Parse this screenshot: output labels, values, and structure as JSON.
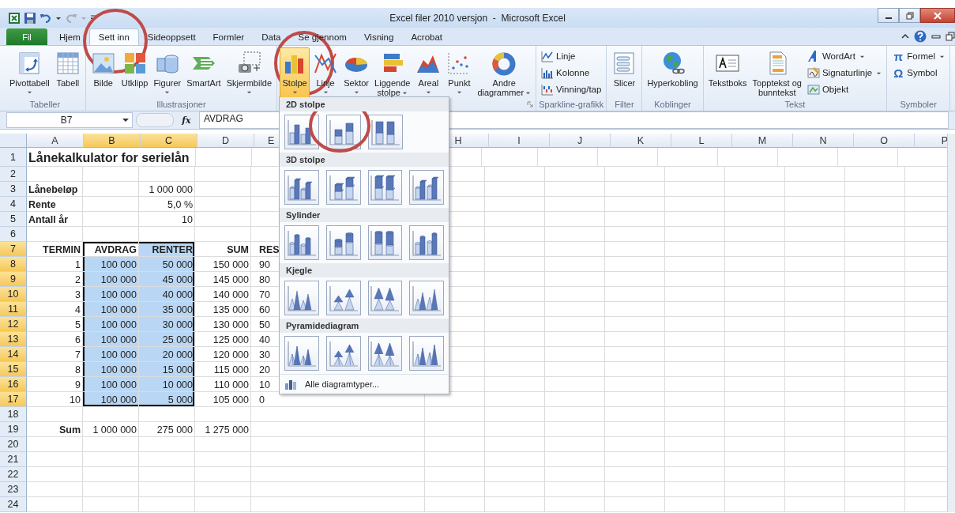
{
  "window": {
    "title": "Excel filer 2010 versjon  -  Microsoft Excel"
  },
  "tabs": [
    {
      "label": "Fil",
      "kind": "file",
      "selected": false
    },
    {
      "label": "Hjem",
      "kind": "tab",
      "selected": false
    },
    {
      "label": "Sett inn",
      "kind": "tab",
      "selected": true
    },
    {
      "label": "Sideoppsett",
      "kind": "tab",
      "selected": false
    },
    {
      "label": "Formler",
      "kind": "tab",
      "selected": false
    },
    {
      "label": "Data",
      "kind": "tab",
      "selected": false
    },
    {
      "label": "Se gjennom",
      "kind": "tab",
      "selected": false
    },
    {
      "label": "Visning",
      "kind": "tab",
      "selected": false
    },
    {
      "label": "Acrobat",
      "kind": "tab",
      "selected": false
    }
  ],
  "ribbon_groups": [
    {
      "label": "Tabeller",
      "items": [
        {
          "label": "Pivottabell",
          "kind": "large",
          "dropdown": true,
          "pressed": false
        },
        {
          "label": "Tabell",
          "kind": "large",
          "dropdown": false,
          "pressed": false
        }
      ]
    },
    {
      "label": "Illustrasjoner",
      "items": [
        {
          "label": "Bilde",
          "kind": "large",
          "dropdown": false,
          "pressed": false
        },
        {
          "label": "Utklipp",
          "kind": "large",
          "dropdown": false,
          "pressed": false
        },
        {
          "label": "Figurer",
          "kind": "large",
          "dropdown": true,
          "pressed": false
        },
        {
          "label": "SmartArt",
          "kind": "large",
          "dropdown": false,
          "pressed": false
        },
        {
          "label": "Skjermbilde",
          "kind": "large",
          "dropdown": true,
          "pressed": false
        }
      ]
    },
    {
      "dialog_launcher": true,
      "items": [
        {
          "label": "Stolpe",
          "kind": "large",
          "dropdown": true,
          "pressed": true
        },
        {
          "label": "Linje",
          "kind": "large",
          "dropdown": true,
          "pressed": false
        },
        {
          "label": "Sektor",
          "kind": "large",
          "dropdown": true,
          "pressed": false
        },
        {
          "label": "Liggende\nstolpe",
          "kind": "large",
          "dropdown": true,
          "pressed": false
        },
        {
          "label": "Areal",
          "kind": "large",
          "dropdown": true,
          "pressed": false
        },
        {
          "label": "Punkt",
          "kind": "large",
          "dropdown": true,
          "pressed": false
        },
        {
          "label": "Andre\ndiagrammer",
          "kind": "large",
          "dropdown": true,
          "pressed": false
        }
      ]
    },
    {
      "label": "Sparkline-grafikk",
      "items": [
        {
          "label": "Linje",
          "kind": "small",
          "dropdown": false,
          "pressed": false
        },
        {
          "label": "Kolonne",
          "kind": "small",
          "dropdown": false,
          "pressed": false
        },
        {
          "label": "Vinning/tap",
          "kind": "small",
          "dropdown": false,
          "pressed": false
        }
      ]
    },
    {
      "label": "Filter",
      "items": [
        {
          "label": "Slicer",
          "kind": "large",
          "dropdown": false,
          "pressed": false
        }
      ]
    },
    {
      "label": "Koblinger",
      "items": [
        {
          "label": "Hyperkobling",
          "kind": "large",
          "dropdown": false,
          "pressed": false
        }
      ]
    },
    {
      "label": "Tekst",
      "items": [
        {
          "label": "Tekstboks",
          "kind": "large",
          "dropdown": false,
          "pressed": false
        },
        {
          "label": "Topptekst og\nbunntekst",
          "kind": "large",
          "dropdown": false,
          "pressed": false
        },
        {
          "label": "WordArt",
          "kind": "small",
          "dropdown": true,
          "pressed": false
        },
        {
          "label": "Signaturlinje",
          "kind": "small",
          "dropdown": true,
          "pressed": false
        },
        {
          "label": "Objekt",
          "kind": "small",
          "dropdown": false,
          "pressed": false
        }
      ]
    },
    {
      "label": "Symboler",
      "items": [
        {
          "label": "Formel",
          "kind": "small",
          "glyph": "π",
          "dropdown": true,
          "pressed": false
        },
        {
          "label": "Symbol",
          "kind": "small",
          "glyph": "Ω",
          "dropdown": false,
          "pressed": false
        }
      ]
    }
  ],
  "formula_bar": {
    "name_box": "B7",
    "fx_label": "fx",
    "formula": "AVDRAG"
  },
  "sheet": {
    "columns": [
      {
        "label": "A",
        "covered": false
      },
      {
        "label": "B",
        "covered": false
      },
      {
        "label": "C",
        "covered": false
      },
      {
        "label": "D",
        "covered": false
      },
      {
        "label": "E",
        "covered": true
      },
      {
        "label": "H",
        "covered": false
      },
      {
        "label": "I",
        "covered": false
      },
      {
        "label": "J",
        "covered": false
      },
      {
        "label": "K",
        "covered": false
      },
      {
        "label": "L",
        "covered": false
      },
      {
        "label": "M",
        "covered": false
      },
      {
        "label": "N",
        "covered": false
      },
      {
        "label": "O",
        "covered": false
      },
      {
        "label": "P",
        "covered": false
      }
    ],
    "rows": [
      {
        "header": "1",
        "kind": "title",
        "cells": {
          "A": {
            "text": "Lånekalkulator for serielån",
            "kind": "text",
            "bold": true,
            "selected": false,
            "active": false
          }
        }
      },
      {
        "header": "2",
        "kind": "normal",
        "cells": {}
      },
      {
        "header": "3",
        "kind": "normal",
        "cells": {
          "A": {
            "text": "Lånebeløp",
            "kind": "text",
            "bold": true,
            "selected": false,
            "active": false
          },
          "C": {
            "text": "1 000 000",
            "kind": "number",
            "bold": false,
            "selected": false,
            "active": false
          }
        }
      },
      {
        "header": "4",
        "kind": "normal",
        "cells": {
          "A": {
            "text": "Rente",
            "kind": "text",
            "bold": true,
            "selected": false,
            "active": false
          },
          "C": {
            "text": "5,0 %",
            "kind": "number",
            "bold": false,
            "selected": false,
            "active": false
          }
        }
      },
      {
        "header": "5",
        "kind": "normal",
        "cells": {
          "A": {
            "text": "Antall år",
            "kind": "text",
            "bold": true,
            "selected": false,
            "active": false
          },
          "C": {
            "text": "10",
            "kind": "number",
            "bold": false,
            "selected": false,
            "active": false
          }
        }
      },
      {
        "header": "6",
        "kind": "normal",
        "cells": {}
      },
      {
        "header": "7",
        "kind": "normal",
        "cells": {
          "A": {
            "text": "TERMIN",
            "kind": "number",
            "bold": true,
            "selected": false,
            "active": false
          },
          "B": {
            "text": "AVDRAG",
            "kind": "number",
            "bold": true,
            "selected": true,
            "active": true
          },
          "C": {
            "text": "RENTER",
            "kind": "number",
            "bold": true,
            "selected": true,
            "active": false
          },
          "D": {
            "text": "SUM",
            "kind": "number",
            "bold": true,
            "selected": false,
            "active": false
          },
          "E": {
            "text": "RES",
            "kind": "number",
            "bold": true,
            "selected": false,
            "active": false
          }
        }
      },
      {
        "header": "8",
        "kind": "normal",
        "cells": {
          "A": {
            "text": "1",
            "kind": "number",
            "bold": false,
            "selected": false,
            "active": false
          },
          "B": {
            "text": "100 000",
            "kind": "number",
            "bold": false,
            "selected": true,
            "active": false
          },
          "C": {
            "text": "50 000",
            "kind": "number",
            "bold": false,
            "selected": true,
            "active": false
          },
          "D": {
            "text": "150 000",
            "kind": "number",
            "bold": false,
            "selected": false,
            "active": false
          },
          "E": {
            "text": "90",
            "kind": "number",
            "bold": false,
            "selected": false,
            "active": false
          }
        }
      },
      {
        "header": "9",
        "kind": "normal",
        "cells": {
          "A": {
            "text": "2",
            "kind": "number",
            "bold": false,
            "selected": false,
            "active": false
          },
          "B": {
            "text": "100 000",
            "kind": "number",
            "bold": false,
            "selected": true,
            "active": false
          },
          "C": {
            "text": "45 000",
            "kind": "number",
            "bold": false,
            "selected": true,
            "active": false
          },
          "D": {
            "text": "145 000",
            "kind": "number",
            "bold": false,
            "selected": false,
            "active": false
          },
          "E": {
            "text": "80",
            "kind": "number",
            "bold": false,
            "selected": false,
            "active": false
          }
        }
      },
      {
        "header": "10",
        "kind": "normal",
        "cells": {
          "A": {
            "text": "3",
            "kind": "number",
            "bold": false,
            "selected": false,
            "active": false
          },
          "B": {
            "text": "100 000",
            "kind": "number",
            "bold": false,
            "selected": true,
            "active": false
          },
          "C": {
            "text": "40 000",
            "kind": "number",
            "bold": false,
            "selected": true,
            "active": false
          },
          "D": {
            "text": "140 000",
            "kind": "number",
            "bold": false,
            "selected": false,
            "active": false
          },
          "E": {
            "text": "70",
            "kind": "number",
            "bold": false,
            "selected": false,
            "active": false
          }
        }
      },
      {
        "header": "11",
        "kind": "normal",
        "cells": {
          "A": {
            "text": "4",
            "kind": "number",
            "bold": false,
            "selected": false,
            "active": false
          },
          "B": {
            "text": "100 000",
            "kind": "number",
            "bold": false,
            "selected": true,
            "active": false
          },
          "C": {
            "text": "35 000",
            "kind": "number",
            "bold": false,
            "selected": true,
            "active": false
          },
          "D": {
            "text": "135 000",
            "kind": "number",
            "bold": false,
            "selected": false,
            "active": false
          },
          "E": {
            "text": "60",
            "kind": "number",
            "bold": false,
            "selected": false,
            "active": false
          }
        }
      },
      {
        "header": "12",
        "kind": "normal",
        "cells": {
          "A": {
            "text": "5",
            "kind": "number",
            "bold": false,
            "selected": false,
            "active": false
          },
          "B": {
            "text": "100 000",
            "kind": "number",
            "bold": false,
            "selected": true,
            "active": false
          },
          "C": {
            "text": "30 000",
            "kind": "number",
            "bold": false,
            "selected": true,
            "active": false
          },
          "D": {
            "text": "130 000",
            "kind": "number",
            "bold": false,
            "selected": false,
            "active": false
          },
          "E": {
            "text": "50",
            "kind": "number",
            "bold": false,
            "selected": false,
            "active": false
          }
        }
      },
      {
        "header": "13",
        "kind": "normal",
        "cells": {
          "A": {
            "text": "6",
            "kind": "number",
            "bold": false,
            "selected": false,
            "active": false
          },
          "B": {
            "text": "100 000",
            "kind": "number",
            "bold": false,
            "selected": true,
            "active": false
          },
          "C": {
            "text": "25 000",
            "kind": "number",
            "bold": false,
            "selected": true,
            "active": false
          },
          "D": {
            "text": "125 000",
            "kind": "number",
            "bold": false,
            "selected": false,
            "active": false
          },
          "E": {
            "text": "40",
            "kind": "number",
            "bold": false,
            "selected": false,
            "active": false
          }
        }
      },
      {
        "header": "14",
        "kind": "normal",
        "cells": {
          "A": {
            "text": "7",
            "kind": "number",
            "bold": false,
            "selected": false,
            "active": false
          },
          "B": {
            "text": "100 000",
            "kind": "number",
            "bold": false,
            "selected": true,
            "active": false
          },
          "C": {
            "text": "20 000",
            "kind": "number",
            "bold": false,
            "selected": true,
            "active": false
          },
          "D": {
            "text": "120 000",
            "kind": "number",
            "bold": false,
            "selected": false,
            "active": false
          },
          "E": {
            "text": "30",
            "kind": "number",
            "bold": false,
            "selected": false,
            "active": false
          }
        }
      },
      {
        "header": "15",
        "kind": "normal",
        "cells": {
          "A": {
            "text": "8",
            "kind": "number",
            "bold": false,
            "selected": false,
            "active": false
          },
          "B": {
            "text": "100 000",
            "kind": "number",
            "bold": false,
            "selected": true,
            "active": false
          },
          "C": {
            "text": "15 000",
            "kind": "number",
            "bold": false,
            "selected": true,
            "active": false
          },
          "D": {
            "text": "115 000",
            "kind": "number",
            "bold": false,
            "selected": false,
            "active": false
          },
          "E": {
            "text": "20",
            "kind": "number",
            "bold": false,
            "selected": false,
            "active": false
          }
        }
      },
      {
        "header": "16",
        "kind": "normal",
        "cells": {
          "A": {
            "text": "9",
            "kind": "number",
            "bold": false,
            "selected": false,
            "active": false
          },
          "B": {
            "text": "100 000",
            "kind": "number",
            "bold": false,
            "selected": true,
            "active": false
          },
          "C": {
            "text": "10 000",
            "kind": "number",
            "bold": false,
            "selected": true,
            "active": false
          },
          "D": {
            "text": "110 000",
            "kind": "number",
            "bold": false,
            "selected": false,
            "active": false
          },
          "E": {
            "text": "10",
            "kind": "number",
            "bold": false,
            "selected": false,
            "active": false
          }
        }
      },
      {
        "header": "17",
        "kind": "normal",
        "cells": {
          "A": {
            "text": "10",
            "kind": "number",
            "bold": false,
            "selected": false,
            "active": false
          },
          "B": {
            "text": "100 000",
            "kind": "number",
            "bold": false,
            "selected": true,
            "active": false
          },
          "C": {
            "text": "5 000",
            "kind": "number",
            "bold": false,
            "selected": true,
            "active": false
          },
          "D": {
            "text": "105 000",
            "kind": "number",
            "bold": false,
            "selected": false,
            "active": false
          },
          "E": {
            "text": "0",
            "kind": "number",
            "bold": false,
            "selected": false,
            "active": false
          }
        }
      },
      {
        "header": "18",
        "kind": "normal",
        "cells": {}
      },
      {
        "header": "19",
        "kind": "normal",
        "cells": {
          "A": {
            "text": "Sum",
            "kind": "number",
            "bold": true,
            "selected": false,
            "active": false
          },
          "B": {
            "text": "1 000 000",
            "kind": "number",
            "bold": false,
            "selected": false,
            "active": false
          },
          "C": {
            "text": "275 000",
            "kind": "number",
            "bold": false,
            "selected": false,
            "active": false
          },
          "D": {
            "text": "1 275 000",
            "kind": "number",
            "bold": false,
            "selected": false,
            "active": false
          }
        }
      },
      {
        "header": "20",
        "kind": "normal",
        "cells": {}
      },
      {
        "header": "21",
        "kind": "normal",
        "cells": {}
      },
      {
        "header": "22",
        "kind": "normal",
        "cells": {}
      },
      {
        "header": "23",
        "kind": "normal",
        "cells": {}
      },
      {
        "header": "24",
        "kind": "normal",
        "cells": {}
      }
    ]
  },
  "chart_menu": {
    "sections": [
      {
        "title": "2D stolpe",
        "kind": "bar",
        "items": [
          {
            "kind": "clustered"
          },
          {
            "kind": "stacked"
          },
          {
            "kind": "stacked100"
          }
        ]
      },
      {
        "title": "3D stolpe",
        "kind": "box",
        "items": [
          {
            "kind": "clustered"
          },
          {
            "kind": "stacked"
          },
          {
            "kind": "stacked100"
          },
          {
            "kind": "depth"
          }
        ]
      },
      {
        "title": "Sylinder",
        "kind": "cylinder",
        "items": [
          {
            "kind": "clustered"
          },
          {
            "kind": "stacked"
          },
          {
            "kind": "stacked100"
          },
          {
            "kind": "depth"
          }
        ]
      },
      {
        "title": "Kjegle",
        "kind": "cone",
        "items": [
          {
            "kind": "clustered"
          },
          {
            "kind": "stacked"
          },
          {
            "kind": "stacked100"
          },
          {
            "kind": "depth"
          }
        ]
      },
      {
        "title": "Pyramidediagram",
        "kind": "pyramid",
        "items": [
          {
            "kind": "clustered"
          },
          {
            "kind": "stacked"
          },
          {
            "kind": "stacked100"
          },
          {
            "kind": "depth"
          }
        ]
      }
    ],
    "footer": "Alle diagramtyper..."
  }
}
